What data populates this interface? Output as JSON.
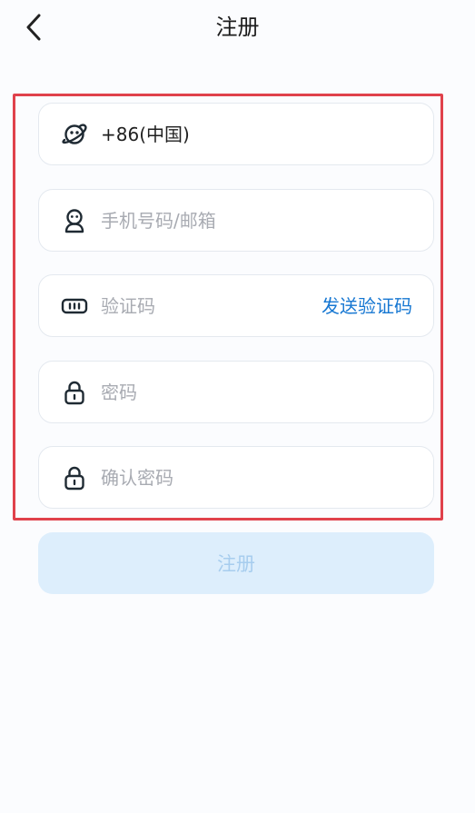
{
  "header": {
    "title": "注册",
    "back_icon": "chevron-left-icon"
  },
  "form": {
    "country": {
      "icon": "planet-icon",
      "value": "+86(中国)"
    },
    "account": {
      "icon": "user-icon",
      "placeholder": "手机号码/邮箱"
    },
    "code": {
      "icon": "keyboard-icon",
      "placeholder": "验证码",
      "send_label": "发送验证码"
    },
    "password": {
      "icon": "lock-icon",
      "placeholder": "密码"
    },
    "confirm_password": {
      "icon": "lock-icon",
      "placeholder": "确认密码"
    }
  },
  "submit": {
    "label": "注册"
  },
  "colors": {
    "accent": "#1677d2",
    "highlight": "#e0414b",
    "button_bg_disabled": "#ddeefc",
    "button_text_disabled": "#a7cdee"
  }
}
